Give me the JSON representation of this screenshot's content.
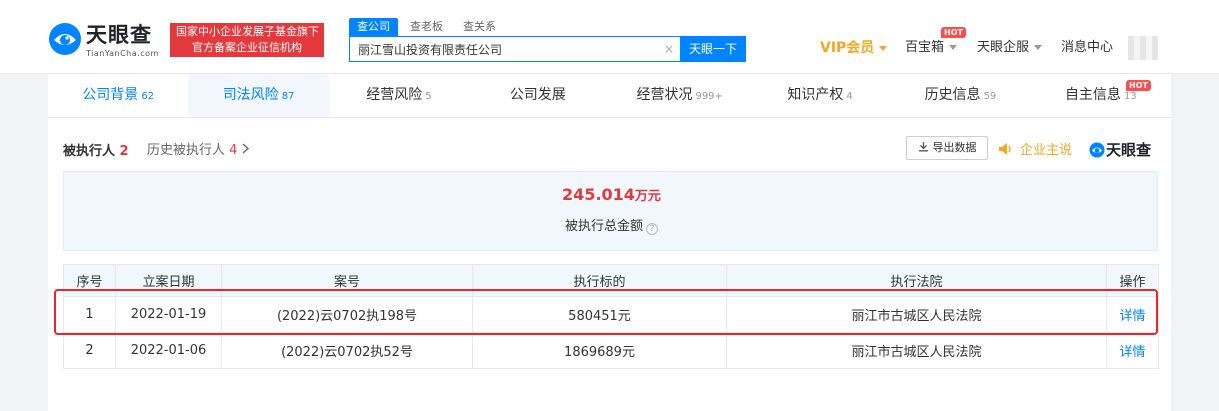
{
  "brand": {
    "name": "天眼查",
    "domain": "TianYanCha.com"
  },
  "gov_badge": {
    "line1": "国家中小企业发展子基金旗下",
    "line2": "官方备案企业征信机构"
  },
  "search": {
    "tabs": [
      "查公司",
      "查老板",
      "查关系"
    ],
    "value": "丽江雪山投资有限责任公司",
    "clear": "×",
    "button": "天眼一下"
  },
  "nav": {
    "vip": "VIP会员",
    "baibaoxiang": "百宝箱",
    "hot": "HOT",
    "service": "天眼企服",
    "messages": "消息中心"
  },
  "tabs": [
    {
      "label": "公司背景",
      "count": "62"
    },
    {
      "label": "司法风险",
      "count": "87"
    },
    {
      "label": "经营风险",
      "count": "5"
    },
    {
      "label": "公司发展",
      "count": ""
    },
    {
      "label": "经营状况",
      "count": "999+"
    },
    {
      "label": "知识产权",
      "count": "4"
    },
    {
      "label": "历史信息",
      "count": "59"
    },
    {
      "label": "自主信息",
      "count": "13"
    }
  ],
  "section": {
    "title": "被执行人",
    "title_count": "2",
    "history": "历史被执行人",
    "history_count": "4",
    "export": "导出数据",
    "speaker": "企业主说",
    "brand_small": "天眼查"
  },
  "summary": {
    "value": "245.014",
    "unit": "万元",
    "label": "被执行总金额",
    "help": "?"
  },
  "table": {
    "headers": [
      "序号",
      "立案日期",
      "案号",
      "执行标的",
      "执行法院",
      "操作"
    ],
    "rows": [
      [
        "1",
        "2022-01-19",
        "(2022)云0702执198号",
        "580451元",
        "丽江市古城区人民法院",
        "详情"
      ],
      [
        "2",
        "2022-01-06",
        "(2022)云0702执52号",
        "1869689元",
        "丽江市古城区人民法院",
        "详情"
      ]
    ]
  },
  "colors": {
    "accent": "#0084ff",
    "danger": "#e4393c",
    "vip": "#f5a623",
    "highlight": "#e8262b"
  },
  "icons": [
    "logo-eye-icon",
    "download-icon",
    "speaker-icon",
    "caret-down-icon",
    "help-circle-icon",
    "chevron-right-icon"
  ]
}
